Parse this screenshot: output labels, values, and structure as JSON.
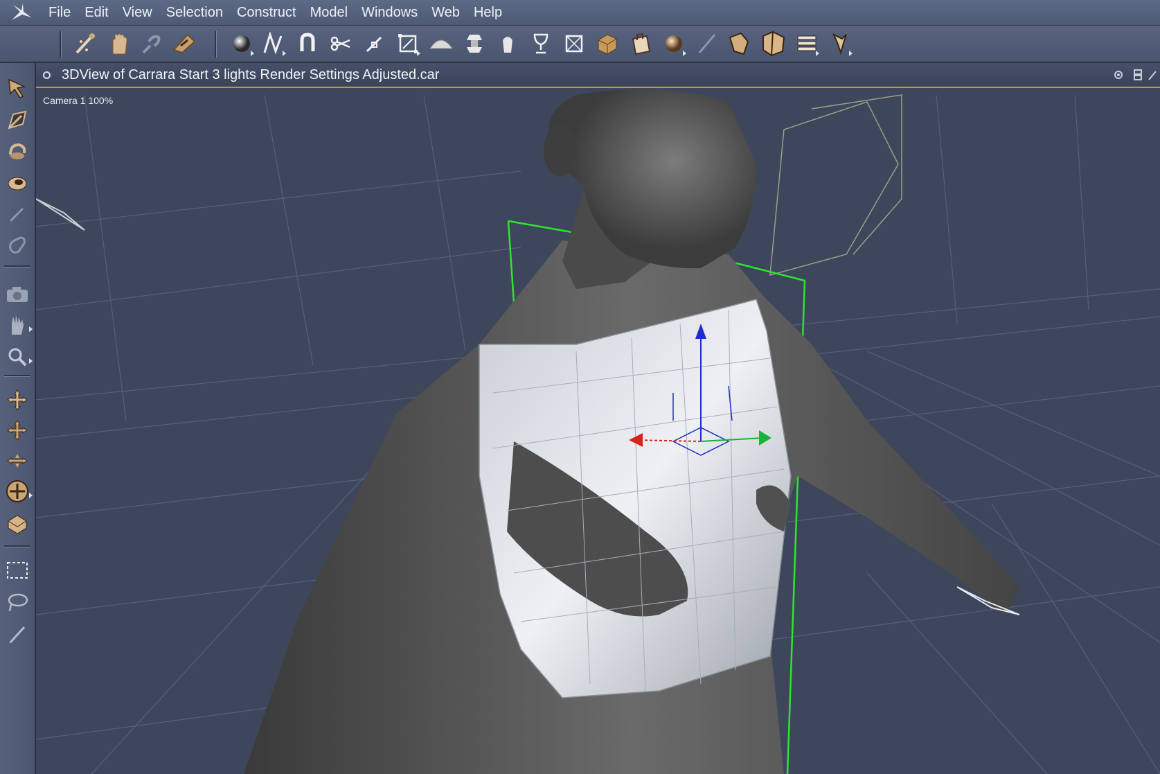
{
  "menubar": {
    "items": [
      "File",
      "Edit",
      "View",
      "Selection",
      "Construct",
      "Model",
      "Windows",
      "Web",
      "Help"
    ]
  },
  "toolbar": {
    "tools": [
      {
        "name": "interactive-render-icon"
      },
      {
        "name": "hand-tool-icon"
      },
      {
        "name": "link-tool-icon"
      },
      {
        "name": "paint-tool-icon"
      },
      {
        "name": "sphere-primitive-icon"
      },
      {
        "name": "spline-tool-icon"
      },
      {
        "name": "magnet-icon"
      },
      {
        "name": "cut-icon"
      },
      {
        "name": "pin-icon"
      },
      {
        "name": "bounding-box-icon"
      },
      {
        "name": "dome-icon"
      },
      {
        "name": "lathe-icon"
      },
      {
        "name": "torch-icon"
      },
      {
        "name": "goblet-icon"
      },
      {
        "name": "plane-icon"
      },
      {
        "name": "box-icon"
      },
      {
        "name": "bag-icon"
      },
      {
        "name": "fur-sphere-icon"
      },
      {
        "name": "line-light-icon"
      },
      {
        "name": "figure-icon"
      },
      {
        "name": "cube-group-icon"
      },
      {
        "name": "hierarchy-icon"
      },
      {
        "name": "pose-icon"
      }
    ]
  },
  "left_toolbar": {
    "tools": [
      {
        "name": "selection-arrow-icon"
      },
      {
        "name": "direct-manipulation-icon"
      },
      {
        "name": "rotate-icon"
      },
      {
        "name": "spiral-icon"
      },
      {
        "name": "eyedropper-icon"
      },
      {
        "name": "link-icon"
      },
      {
        "name": "camera-icon"
      },
      {
        "name": "pan-hand-icon"
      },
      {
        "name": "zoom-icon"
      },
      {
        "name": "move-planar-icon"
      },
      {
        "name": "move-cross-icon"
      },
      {
        "name": "move-axis-icon"
      },
      {
        "name": "move-circle-icon"
      },
      {
        "name": "texture-mapping-icon"
      },
      {
        "name": "marquee-select-icon"
      },
      {
        "name": "lasso-select-icon"
      },
      {
        "name": "brush-icon"
      }
    ]
  },
  "view": {
    "title": "3DView of Carrara Start 3 lights Render Settings Adjusted.car",
    "camera_label": "Camera 1 100%"
  },
  "colors": {
    "accent": "#b79a3c",
    "x_axis": "#d8231c",
    "y_axis": "#1f2ec8",
    "z_axis": "#19b23a",
    "bounding_box": "#2ee62e"
  }
}
